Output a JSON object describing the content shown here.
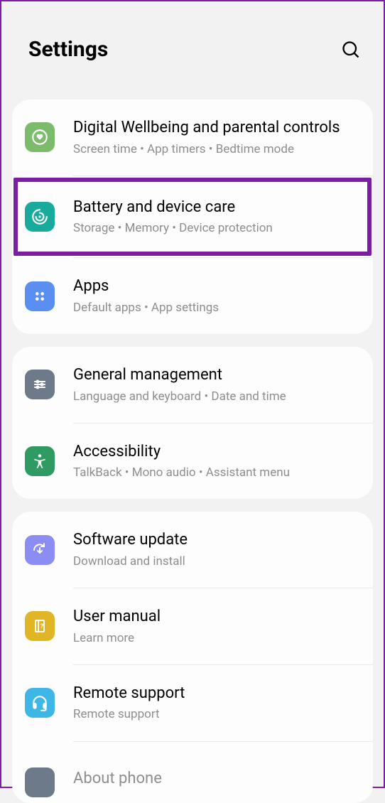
{
  "header": {
    "title": "Settings"
  },
  "s1": {
    "r1": {
      "title": "Digital Wellbeing and parental controls",
      "sub": "Screen time  •  App timers  •  Bedtime mode",
      "color": "#7cbb6c"
    },
    "r2": {
      "title": "Battery and device care",
      "sub": "Storage  •  Memory  •  Device protection",
      "color": "#18ab9b"
    },
    "r3": {
      "title": "Apps",
      "sub": "Default apps  •  App settings",
      "color": "#5a8ef0"
    }
  },
  "s2": {
    "r1": {
      "title": "General management",
      "sub": "Language and keyboard  •  Date and time",
      "color": "#6c7a8a"
    },
    "r2": {
      "title": "Accessibility",
      "sub": "TalkBack  •  Mono audio  •  Assistant menu",
      "color": "#2f9b63"
    }
  },
  "s3": {
    "r1": {
      "title": "Software update",
      "sub": "Download and install",
      "color": "#8b8df2"
    },
    "r2": {
      "title": "User manual",
      "sub": "Learn more",
      "color": "#e0b626"
    },
    "r3": {
      "title": "Remote support",
      "sub": "Remote support",
      "color": "#3fb7e6"
    },
    "r4": {
      "title": "About phone",
      "color": "#6c7a8a"
    }
  }
}
